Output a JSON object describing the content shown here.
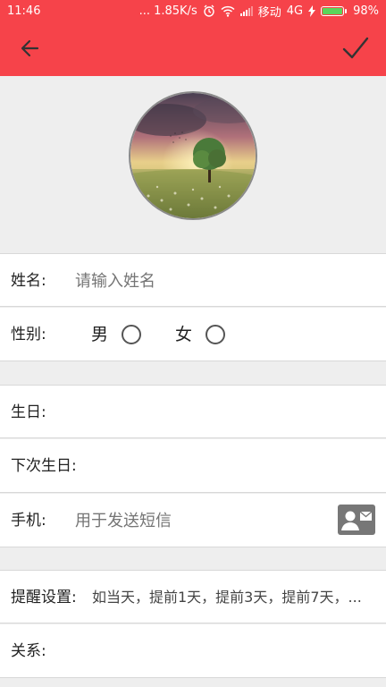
{
  "status_bar": {
    "time": "11:46",
    "network_speed": "... 1.85K/s",
    "carrier": "移动",
    "network_type": "4G",
    "battery": "98%",
    "battery_level": 0.98
  },
  "toolbar": {
    "back_icon": "arrow-left-icon",
    "confirm_icon": "check-icon",
    "background_color": "#f6434a"
  },
  "form": {
    "name": {
      "label": "姓名:",
      "placeholder": "请输入姓名"
    },
    "gender": {
      "label": "性别:",
      "options": [
        "男",
        "女"
      ]
    },
    "birthday": {
      "label": "生日:"
    },
    "next_birthday": {
      "label": "下次生日:"
    },
    "phone": {
      "label": "手机:",
      "placeholder": "用于发送短信",
      "contact_icon": "contact-card-icon"
    },
    "reminder": {
      "label": "提醒设置:",
      "value": "如当天，提前1天，提前3天，提前7天，..."
    },
    "relation": {
      "label": "关系:"
    }
  }
}
